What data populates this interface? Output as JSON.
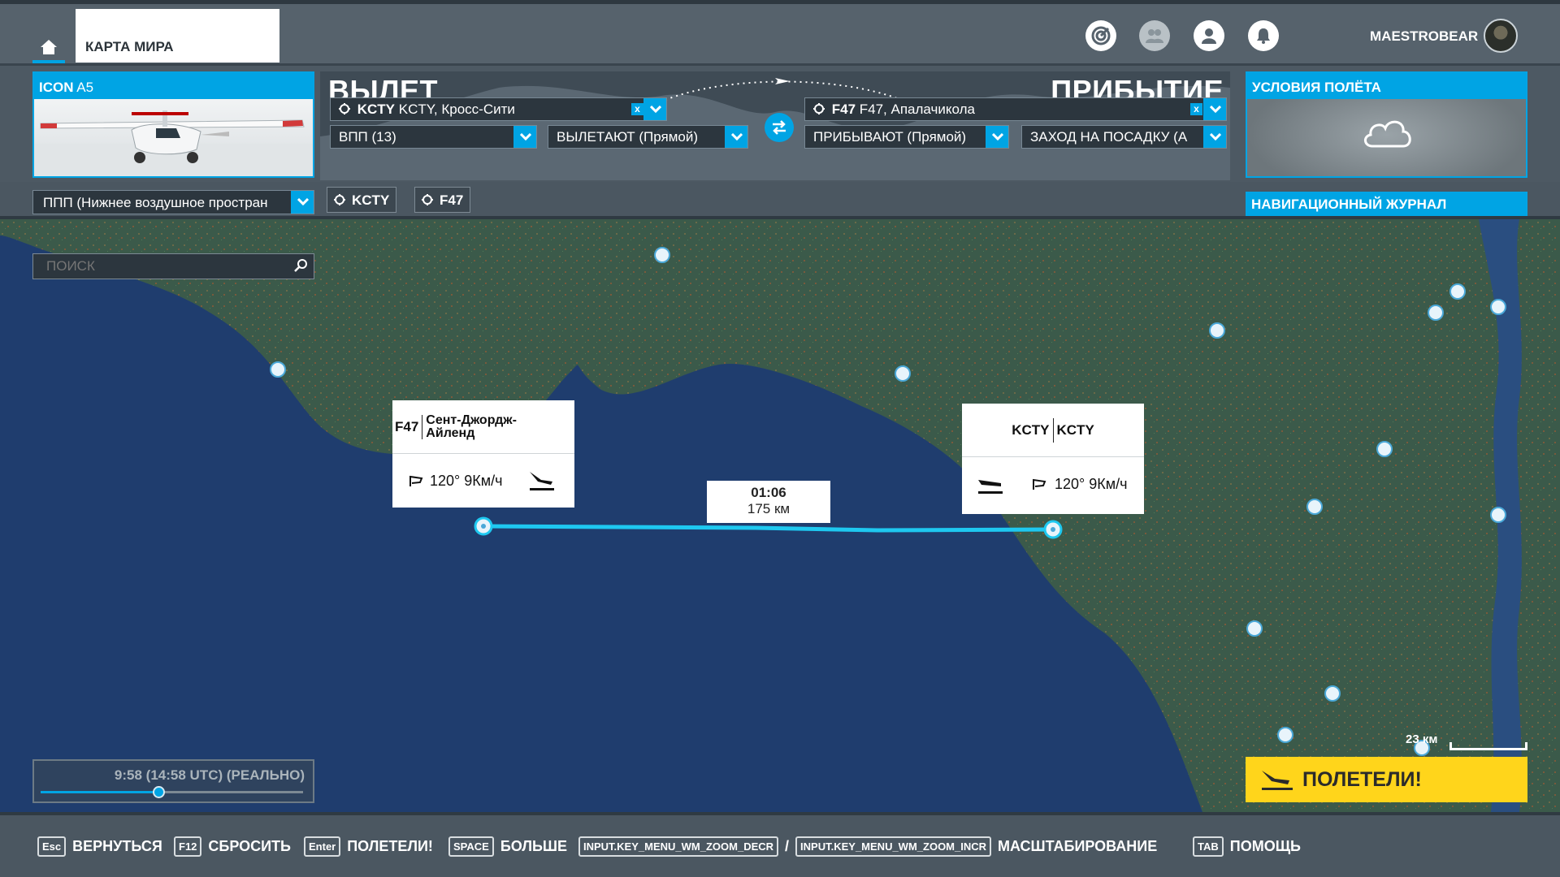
{
  "topbar": {
    "home_icon": "home-icon",
    "world_map_tab": "КАРТА МИРА",
    "icons": [
      "activity-icon",
      "friends-icon",
      "profile-icon",
      "notifications-icon"
    ],
    "username": "MAESTROBEAR"
  },
  "aircraft": {
    "maker": "ICON",
    "model": "A5"
  },
  "route": {
    "departure_label": "ВЫЛЕТ",
    "arrival_label": "ПРИБЫТИЕ",
    "departure": {
      "code": "KCTY",
      "name": "KCTY, Кросс-Сити"
    },
    "arrival": {
      "code": "F47",
      "name": "F47, Апалачикола"
    },
    "clear_label": "x",
    "runway": "ВПП (13)",
    "departure_type": "ВЫЛЕТАЮТ (Прямой)",
    "arrival_type": "ПРИБЫВАЮТ (Прямой)",
    "approach": "ЗАХОД НА ПОСАДКУ (А"
  },
  "conditions": {
    "title": "УСЛОВИЯ ПОЛЁТА",
    "weather_icon": "cloud-icon"
  },
  "subbar": {
    "flight_rules": "ППП (Нижнее воздушное простран",
    "chips": [
      "KCTY",
      "F47"
    ],
    "navlog": "НАВИГАЦИОННЫЙ ЖУРНАЛ"
  },
  "map": {
    "search_placeholder": "ПОИСК",
    "origin_card": {
      "code": "F47",
      "name": "Сент-Джордж-Айленд",
      "wind": "120° 9Км/ч"
    },
    "dest_card": {
      "code": "KCTY",
      "name": "KCTY",
      "wind": "120° 9Км/ч"
    },
    "leg": {
      "time": "01:06",
      "distance": "175 км"
    },
    "time_slider": {
      "label": "9:58 (14:58 UTC) (РЕАЛЬНО)",
      "position": 0.42
    },
    "scale_label": "23 км",
    "fly_button": "ПОЛЕТЕЛИ!",
    "colors": {
      "sea": "#1f3d6e",
      "land": "#3c5a4a",
      "route": "#1ec8f0"
    }
  },
  "hotkeys": [
    {
      "key": "Esc",
      "label": "ВЕРНУТЬСЯ"
    },
    {
      "key": "F12",
      "label": "СБРОСИТЬ"
    },
    {
      "key": "Enter",
      "label": "ПОЛЕТЕЛИ!"
    },
    {
      "key": "SPACE",
      "label": "БОЛЬШЕ"
    },
    {
      "key": "INPUT.KEY_MENU_WM_ZOOM_DECR",
      "sep": "/"
    },
    {
      "key": "INPUT.KEY_MENU_WM_ZOOM_INCR",
      "label": "МАСШТАБИРОВАНИЕ"
    },
    {
      "key": "TAB",
      "label": "ПОМОЩЬ"
    }
  ]
}
